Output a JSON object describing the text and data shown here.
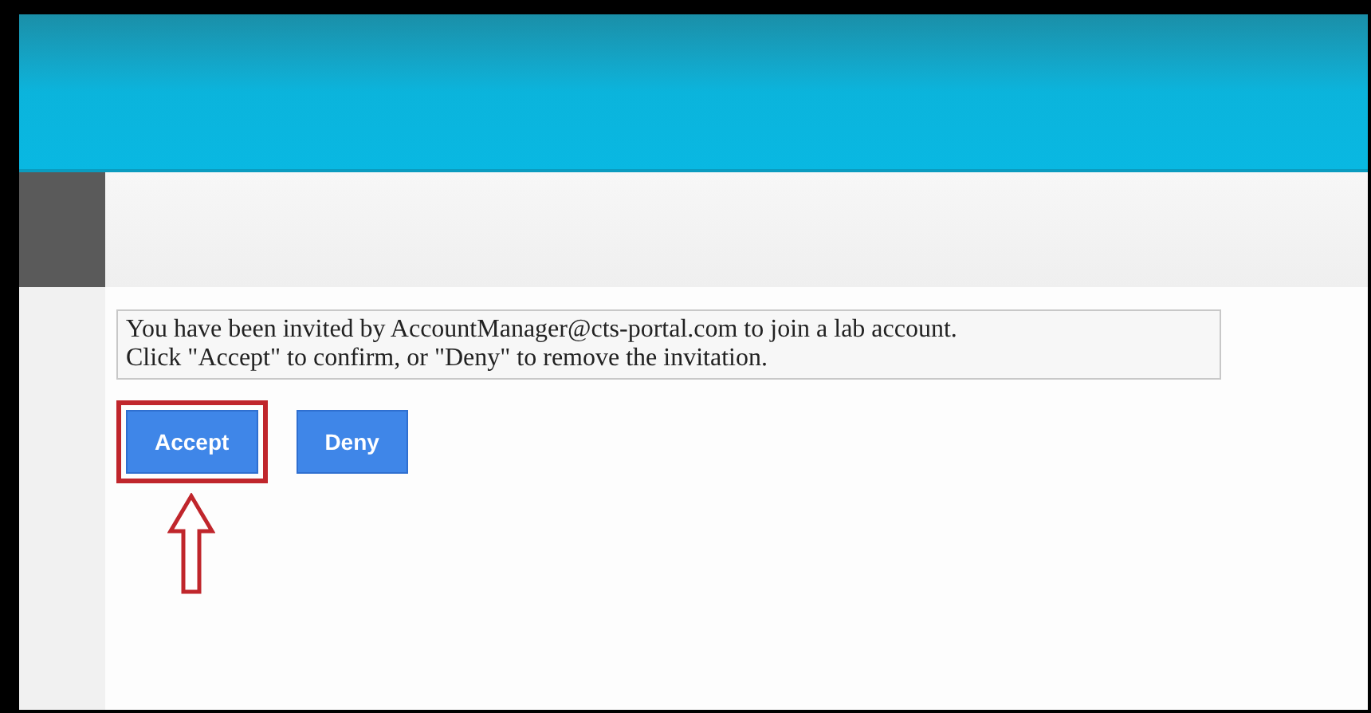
{
  "message": {
    "lines": [
      "You have been invited by AccountManager@cts-portal.com to join a lab account.",
      "Click \"Accept\" to confirm, or \"Deny\" to remove the invitation."
    ]
  },
  "buttons": [
    {
      "label": "Accept",
      "highlighted": true
    },
    {
      "label": "Deny",
      "highlighted": false
    }
  ]
}
